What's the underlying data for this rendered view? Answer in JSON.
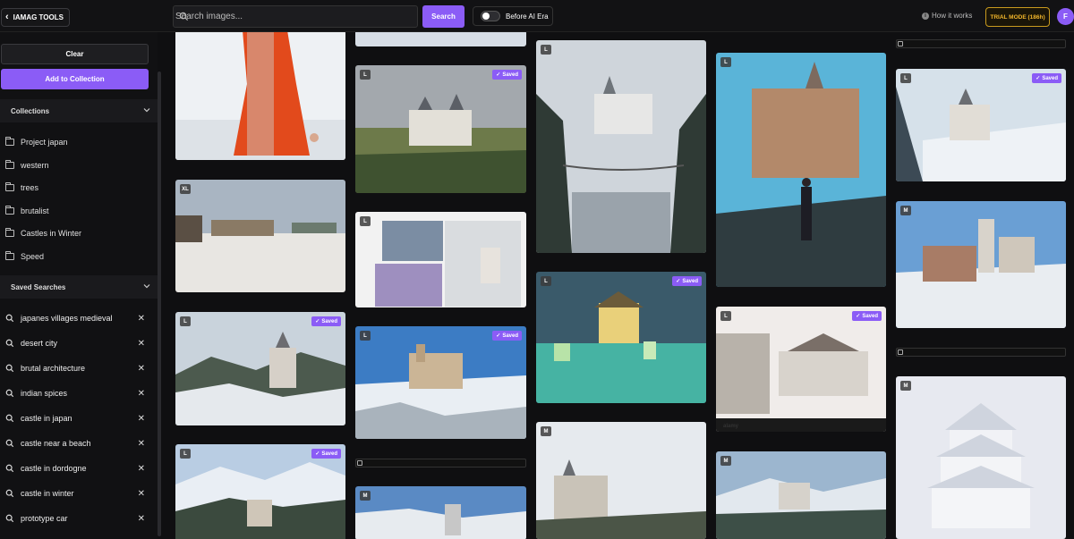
{
  "app": {
    "back_label": "IAMAG TOOLS"
  },
  "search": {
    "placeholder": "Search images...",
    "button_label": "Search"
  },
  "toggle": {
    "label": "Before AI Era",
    "checked": false
  },
  "how_it_works": "How it works",
  "trial_badge": "TRIAL MODE (186h)",
  "avatar_initial": "F",
  "sidebar": {
    "clear_label": "Clear",
    "add_to_collection_label": "Add to Collection",
    "collections_title": "Collections",
    "collections": [
      "Project japan",
      "western",
      "trees",
      "brutalist",
      "Castles in Winter",
      "Speed"
    ],
    "saved_searches_title": "Saved Searches",
    "saved_searches": [
      "japanes villages medieval",
      "desert city",
      "brutal architecture",
      "indian spices",
      "castle in japan",
      "castle near a beach",
      "castle in dordogne",
      "castle in winter",
      "prototype car"
    ]
  },
  "grid": {
    "saved_label": "Saved",
    "alamy_label": "alamy",
    "cards": [
      {
        "badge": "",
        "saved": false,
        "scene": "woman-red-coat"
      },
      {
        "badge": "XL",
        "saved": false,
        "scene": "snowy-field-castle"
      },
      {
        "badge": "L",
        "saved": true,
        "scene": "winter-castle-forest"
      },
      {
        "badge": "L",
        "saved": true,
        "scene": "snowy-mountain-castle"
      },
      {
        "badge": "",
        "saved": false,
        "scene": "snowy-top"
      },
      {
        "badge": "L",
        "saved": true,
        "scene": "neuschwanstein-autumn"
      },
      {
        "badge": "L",
        "saved": false,
        "scene": "collage-castle"
      },
      {
        "badge": "L",
        "saved": true,
        "scene": "segovia-snow"
      },
      {
        "badge": "M",
        "saved": false,
        "scene": "castle-blue-sky"
      },
      {
        "badge": "L",
        "saved": false,
        "scene": "castle-foggy-bridge"
      },
      {
        "badge": "L",
        "saved": true,
        "scene": "japan-castle-night"
      },
      {
        "badge": "M",
        "saved": false,
        "scene": "castle-snow-forest"
      },
      {
        "badge": "L",
        "saved": false,
        "scene": "woman-bridge-castle"
      },
      {
        "badge": "L",
        "saved": true,
        "scene": "japanese-village-snow"
      },
      {
        "badge": "M",
        "saved": false,
        "scene": "castle-mountain-lake"
      },
      {
        "badge": "L",
        "saved": true,
        "scene": "castle-winter-trees"
      },
      {
        "badge": "M",
        "saved": false,
        "scene": "castle-people-snow"
      },
      {
        "badge": "M",
        "saved": false,
        "scene": "japanese-castle-snowfall"
      }
    ]
  },
  "colors": {
    "accent": "#8b5cf6",
    "trial": "#f1b52a",
    "background": "#0f0f11"
  }
}
